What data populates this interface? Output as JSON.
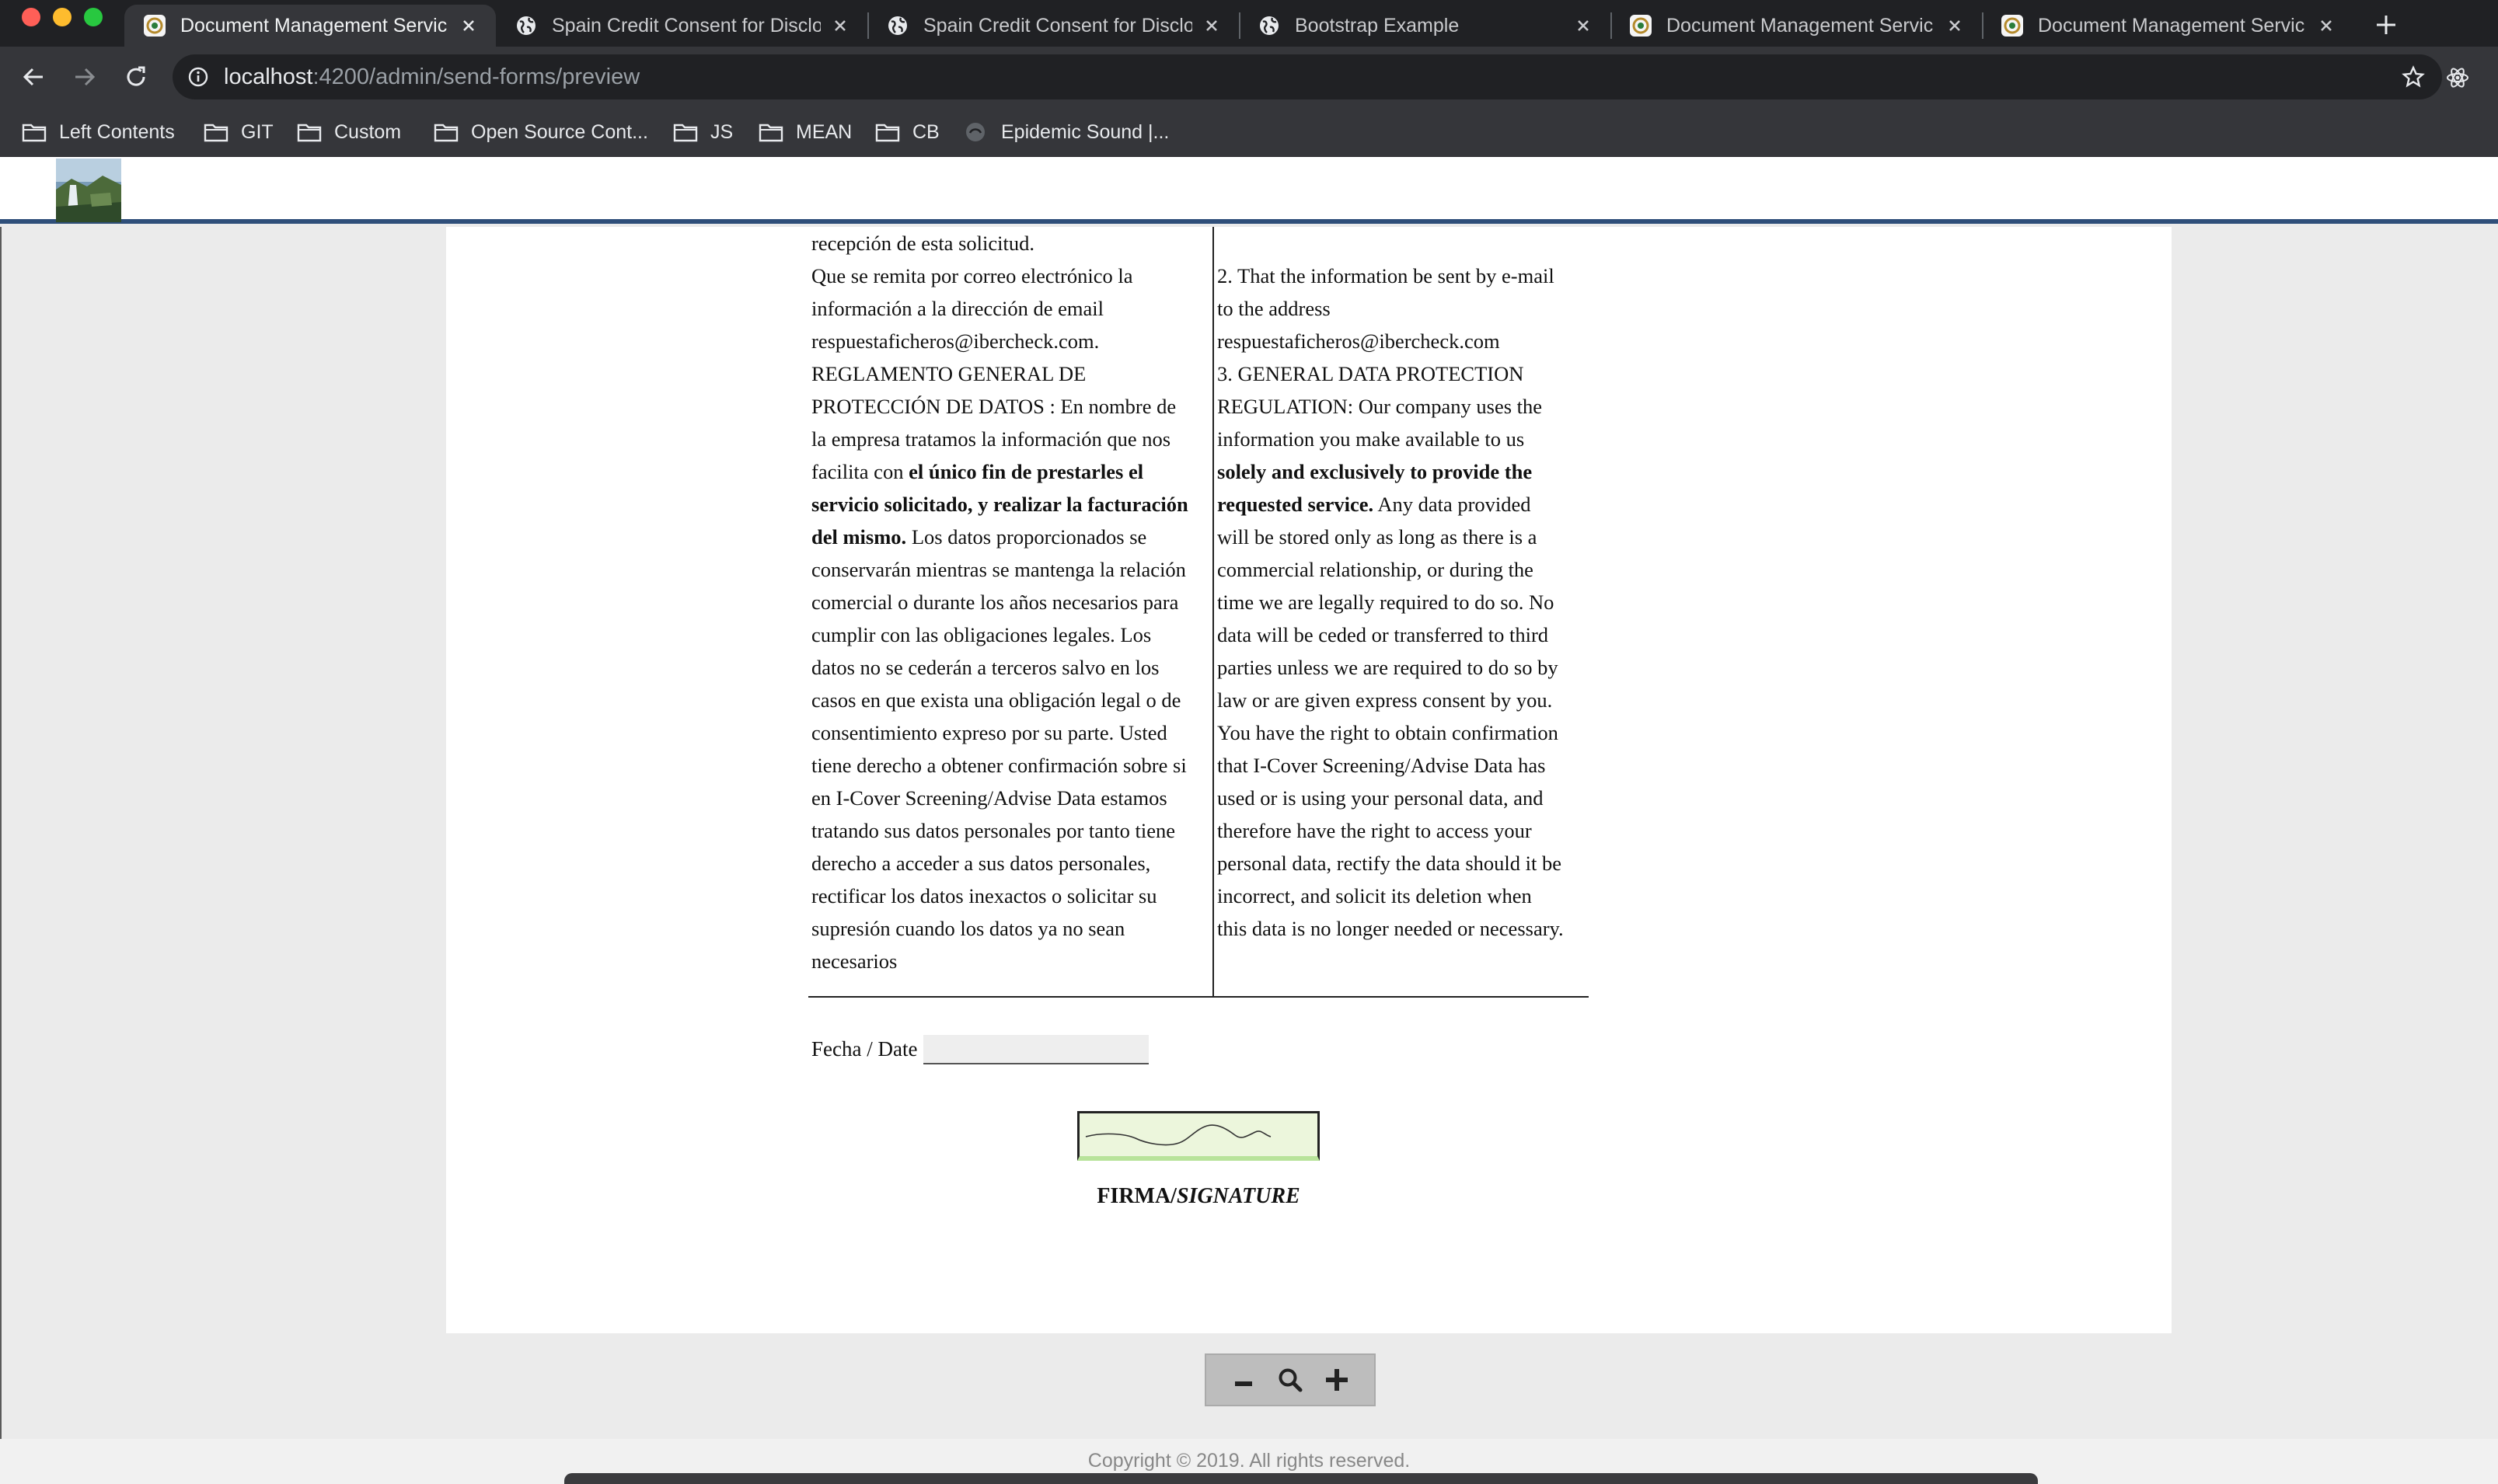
{
  "browser": {
    "tabs": [
      {
        "title": "Document Management Servic",
        "favicon": "app-logo-icon",
        "active": true
      },
      {
        "title": "Spain Credit Consent for Disclo",
        "favicon": "globe-icon",
        "active": false
      },
      {
        "title": "Spain Credit Consent for Disclo",
        "favicon": "globe-icon",
        "active": false
      },
      {
        "title": "Bootstrap Example",
        "favicon": "globe-icon",
        "active": false
      },
      {
        "title": "Document Management Servic",
        "favicon": "app-logo-icon",
        "active": false
      },
      {
        "title": "Document Management Servic",
        "favicon": "app-logo-icon",
        "active": false
      }
    ],
    "url_host": "localhost",
    "url_path": ":4200/admin/send-forms/preview",
    "bookmarks": [
      {
        "label": "Left Contents",
        "icon": "folder-icon"
      },
      {
        "label": "GIT",
        "icon": "folder-icon"
      },
      {
        "label": "Custom",
        "icon": "folder-icon"
      },
      {
        "label": "Open Source Cont...",
        "icon": "folder-icon"
      },
      {
        "label": "JS",
        "icon": "folder-icon"
      },
      {
        "label": "MEAN",
        "icon": "folder-icon"
      },
      {
        "label": "CB",
        "icon": "folder-icon"
      },
      {
        "label": "Epidemic Sound |...",
        "icon": "epidemic-sound-icon"
      }
    ]
  },
  "document": {
    "es_line_0": "recepción de esta solicitud.",
    "es_email_1": "Que se remita por correo electrónico la",
    "es_email_2": "información a la dirección de email",
    "es_email_3": "respuestaficheros@ibercheck.com.",
    "en_email_1": "2. That the information be sent by e-mail",
    "en_email_2": "to the address",
    "en_email_3": "respuestaficheros@ibercheck.com",
    "es_gdpr": {
      "l1": "REGLAMENTO GENERAL DE",
      "l2": "PROTECCIÓN DE DATOS : En nombre de",
      "l3": "la empresa tratamos la información que nos",
      "l4a": "facilita con ",
      "l4b": "el único fin de prestarles el",
      "l5": "servicio solicitado, y realizar la facturación",
      "l6a": "del mismo.",
      "l6b": " Los datos proporcionados se",
      "l7": "conservarán mientras se mantenga la relación",
      "l8": "comercial o durante los años necesarios para",
      "l9": "cumplir con las obligaciones legales. Los",
      "l10": "datos no se cederán a terceros salvo en los",
      "l11": "casos en que exista una obligación legal o de",
      "l12": "consentimiento expreso por su parte. Usted",
      "l13": "tiene derecho a obtener confirmación sobre si",
      "l14": "en I-Cover Screening/Advise Data estamos",
      "l15": "tratando sus datos personales por tanto tiene",
      "l16": "derecho a acceder a sus datos personales,",
      "l17": "rectificar los datos inexactos o solicitar su",
      "l18": "supresión cuando los datos ya no sean",
      "l19": "necesarios"
    },
    "en_gdpr": {
      "l1": "3. GENERAL DATA PROTECTION",
      "l2": "REGULATION: Our company uses the",
      "l3": "information you make available to us",
      "l4": "solely and exclusively to provide the",
      "l5a": "requested service.",
      "l5b": " Any data provided",
      "l6": "will be stored only as long as there is a",
      "l7": "commercial relationship, or during the",
      "l8": "time we are legally required to do so. No",
      "l9": "data will be ceded or transferred to third",
      "l10": "parties unless we are required to do so by",
      "l11": "law or are given express consent by you.",
      "l12": "You have the right to obtain confirmation",
      "l13": "that I-Cover Screening/Advise Data has",
      "l14": "used or is using your personal data, and",
      "l15": "therefore have the right to access your",
      "l16": "personal data, rectify the data should it be",
      "l17": "incorrect, and solicit its deletion when",
      "l18": "this data is no longer needed or necessary."
    },
    "date_label": "Fecha / Date",
    "date_value": "",
    "signature_label_es": "FIRMA/",
    "signature_label_en": "SIGNATURE"
  },
  "zoom": {
    "out_icon": "minus-icon",
    "reset_icon": "magnifier-icon",
    "in_icon": "plus-icon"
  },
  "footer": {
    "copyright": "Copyright © 2019. All rights reserved."
  },
  "colors": {
    "header_rule": "#2f4f7a",
    "signature_fill": "#ecf6dc",
    "tab_active": "#35363a",
    "tabstrip": "#202124"
  }
}
